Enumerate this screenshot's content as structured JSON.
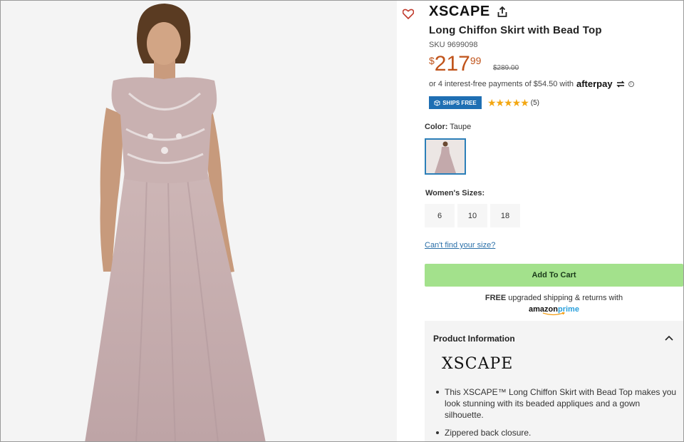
{
  "product": {
    "brand": "XSCAPE",
    "title": "Long Chiffon Skirt with Bead Top",
    "sku_label": "SKU",
    "sku": "9699098",
    "price": {
      "currency": "$",
      "dollars": "217",
      "cents": "99",
      "original": "$289.00"
    },
    "afterpay_text": "or 4 interest-free payments of $54.50 with",
    "afterpay_brand": "afterpay",
    "ships_badge": "SHIPS FREE",
    "rating": {
      "stars": "★★★★★",
      "value": 5,
      "count": "(5)"
    }
  },
  "color": {
    "label": "Color:",
    "value": "Taupe"
  },
  "sizes": {
    "label": "Women's Sizes:",
    "options": [
      "6",
      "10",
      "18"
    ]
  },
  "links": {
    "find_size": "Can't find your size?"
  },
  "cart": {
    "button": "Add To Cart"
  },
  "shipping": {
    "free": "FREE",
    "rest": "upgraded shipping & returns with",
    "prime_a": "amazon",
    "prime_b": "prime"
  },
  "info": {
    "heading": "Product Information",
    "logo_text": "XSCAPE",
    "bullets": [
      "This XSCAPE™ Long Chiffon Skirt with Bead Top makes you look stunning with its beaded appliques and a gown silhouette.",
      "Zippered back closure."
    ]
  },
  "colors": {
    "accent": "#c0531a",
    "cta": "#a3e18c",
    "badge": "#1f6fb3",
    "link": "#2a6fa8",
    "stars": "#f3a712"
  },
  "icons": [
    "heart-icon",
    "share-icon",
    "box-icon",
    "star-icon",
    "info-icon",
    "chevron-up-icon"
  ]
}
